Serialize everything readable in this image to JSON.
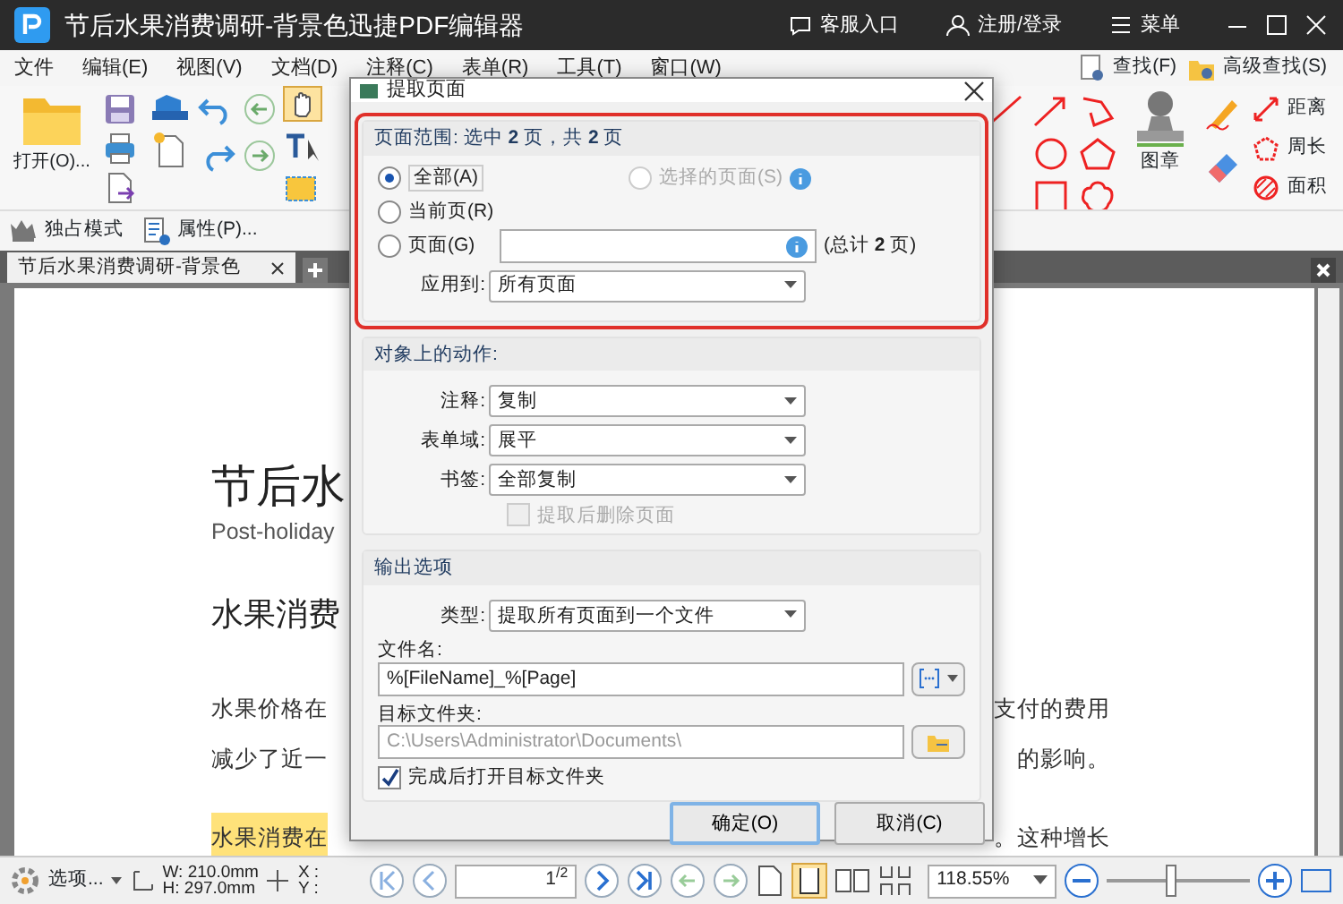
{
  "window": {
    "title": "节后水果消费调研-背景色迅捷PDF编辑器",
    "actions": [
      "客服入口",
      "注册/登录",
      "菜单"
    ]
  },
  "menu": [
    "文件",
    "编辑(E)",
    "视图(V)",
    "文档(D)",
    "注释(C)",
    "表单(R)",
    "工具(T)",
    "窗口(W)"
  ],
  "search_buttons": [
    "查找(F)",
    "高级查找(S)"
  ],
  "ribbon": {
    "open": "打开(O)...",
    "stamp": "图章",
    "measure": [
      "距离",
      "周长",
      "面积"
    ]
  },
  "quick": [
    "独占模式",
    "属性(P)..."
  ],
  "tabs": [
    {
      "label": "节后水果消费调研-背景色",
      "selected": true
    }
  ],
  "document": {
    "lines": [
      {
        "kind": "title",
        "left": "节后水"
      },
      {
        "kind": "subtitle",
        "left": "Post-holiday"
      },
      {
        "kind": "heading",
        "left": "水果消费"
      },
      {
        "kind": "body",
        "left": "水果价格在",
        "right": "支付的费用",
        "highlighted": false
      },
      {
        "kind": "body",
        "left": "减少了近一",
        "right": "的影响。",
        "highlighted": false
      },
      {
        "kind": "body",
        "left": "水果消费在",
        "right": "。这种增长",
        "highlighted": true
      }
    ]
  },
  "dialog": {
    "title": "提取页面",
    "range": {
      "heading": "页面范围: 选中 **2** 页，共 **2** 页",
      "options": [
        {
          "label": "全部(A)",
          "selected": true,
          "disabled": false
        },
        {
          "label": "选择的页面(S)",
          "selected": false,
          "disabled": true
        },
        {
          "label": "当前页(R)",
          "selected": false,
          "disabled": false
        },
        {
          "label": "页面(G)",
          "selected": false,
          "disabled": false
        }
      ],
      "total": "(总计 **2** 页)",
      "apply_label": "应用到:",
      "apply_value": "所有页面"
    },
    "actions": {
      "heading": "对象上的动作:",
      "selects": [
        {
          "label": "注释:",
          "value": "复制"
        },
        {
          "label": "表单域:",
          "value": "展平"
        },
        {
          "label": "书签:",
          "value": "全部复制"
        }
      ],
      "delete_after": {
        "label": "提取后删除页面",
        "checked": false,
        "disabled": true
      }
    },
    "output": {
      "heading": "输出选项",
      "type_label": "类型:",
      "type_value": "提取所有页面到一个文件",
      "filename_label": "文件名:",
      "filename": "%[FileName]_%[Page]",
      "folder_label": "目标文件夹:",
      "folder": "C:\\Users\\Administrator\\Documents\\",
      "open_after": {
        "label": "完成后打开目标文件夹",
        "checked": true
      }
    },
    "buttons": [
      {
        "label": "确定(O)",
        "default": true
      },
      {
        "label": "取消(C)",
        "default": false
      }
    ]
  },
  "status": {
    "options": "选项...",
    "size": [
      "W: 210.0mm",
      "H: 297.0mm"
    ],
    "coords": [
      "X :",
      "Y :"
    ],
    "page": "1",
    "pages": "/2",
    "zoom": "118.55%",
    "zoom_slider": {
      "level": 0.45
    }
  }
}
